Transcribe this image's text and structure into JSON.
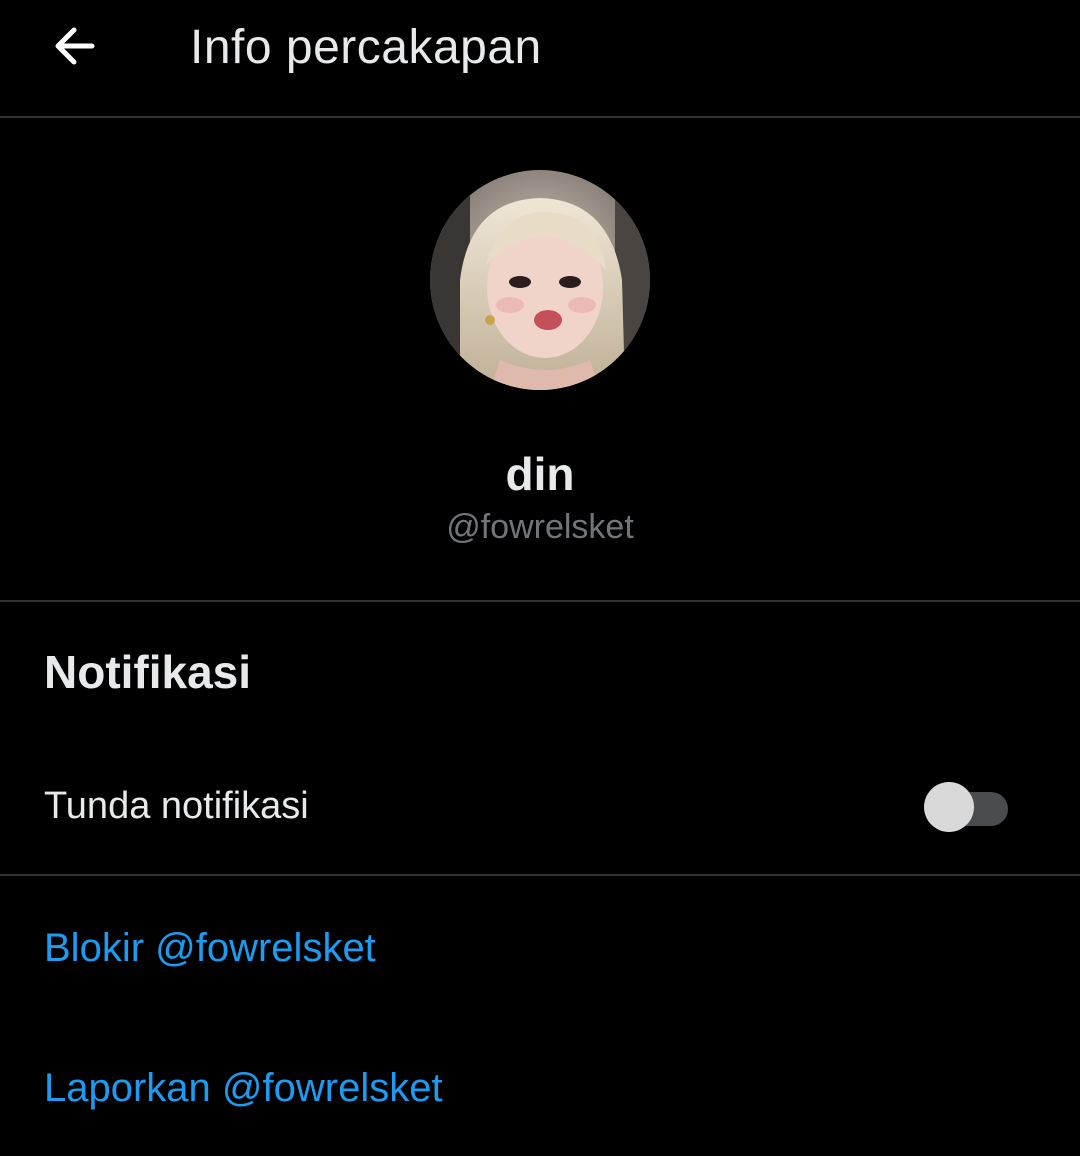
{
  "header": {
    "back_icon": "back-arrow-icon",
    "title": "Info percakapan"
  },
  "profile": {
    "display_name": "din",
    "handle": "@fowrelsket"
  },
  "notifications": {
    "section_title": "Notifikasi",
    "snooze_label": "Tunda notifikasi",
    "snooze_enabled": false
  },
  "actions": {
    "block_label": "Blokir @fowrelsket",
    "report_label": "Laporkan @fowrelsket"
  },
  "colors": {
    "background": "#000000",
    "text_primary": "#e7e9ea",
    "text_secondary": "#71767b",
    "link": "#1d9bf0",
    "divider": "#2f3336"
  }
}
